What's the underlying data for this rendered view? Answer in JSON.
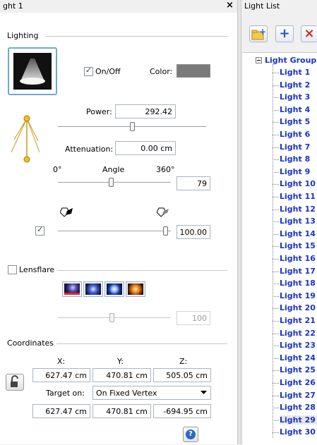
{
  "left_panel": {
    "title": "ght 1",
    "close_glyph": "×",
    "lighting_group": "Lighting",
    "on_off_label": "On/Off",
    "on_off_checked": true,
    "color_label": "Color:",
    "light_color": "#7a7a7a",
    "power_label": "Power:",
    "power_value": "292.42",
    "power_level": 0.5,
    "attenuation_label": "Attenuation:",
    "attenuation_value": "0.00 cm",
    "angle_min": "0°",
    "angle_label": "Angle",
    "angle_max": "360°",
    "angle_value": "79",
    "intensity_checked": true,
    "intensity_value": "100.00",
    "intensity_level": 1.0,
    "lensflare_label": "Lensflare",
    "lensflare_checked": false,
    "lensflare_value": "100",
    "lensflare_level": 0.5,
    "coordinates_group": "Coordinates",
    "x_label": "X:",
    "y_label": "Y:",
    "z_label": "Z:",
    "x_value": "627.47 cm",
    "y_value": "470.81 cm",
    "z_value": "505.05 cm",
    "target_label": "Target on:",
    "target_option": "On Fixed Vertex",
    "target_x": "627.47 cm",
    "target_y": "470.81 cm",
    "target_z": "-694.95 cm",
    "help_glyph": "?"
  },
  "right_panel": {
    "title": "Light List",
    "tree_root": "Light Group",
    "tree_items": [
      "Light 1",
      "Light 2",
      "Light 3",
      "Light 4",
      "Light 5",
      "Light 6",
      "Light 7",
      "Light 8",
      "Light 9",
      "Light 10",
      "Light 11",
      "Light 12",
      "Light 13",
      "Light 14",
      "Light 15",
      "Light 16",
      "Light 17",
      "Light 18",
      "Light 19",
      "Light 20",
      "Light 21",
      "Light 22",
      "Light 23",
      "Light 24",
      "Light 25",
      "Light 26",
      "Light 27",
      "Light 28",
      "Light 29",
      "Light 30"
    ],
    "selected_item": "Light 29",
    "toolbar": {
      "add_glyph": "+",
      "delete_glyph": "×"
    }
  },
  "colors": {
    "tree_text": "#1a33c8",
    "accent_blue": "#2a68c4",
    "delete_red": "#d8231f"
  }
}
